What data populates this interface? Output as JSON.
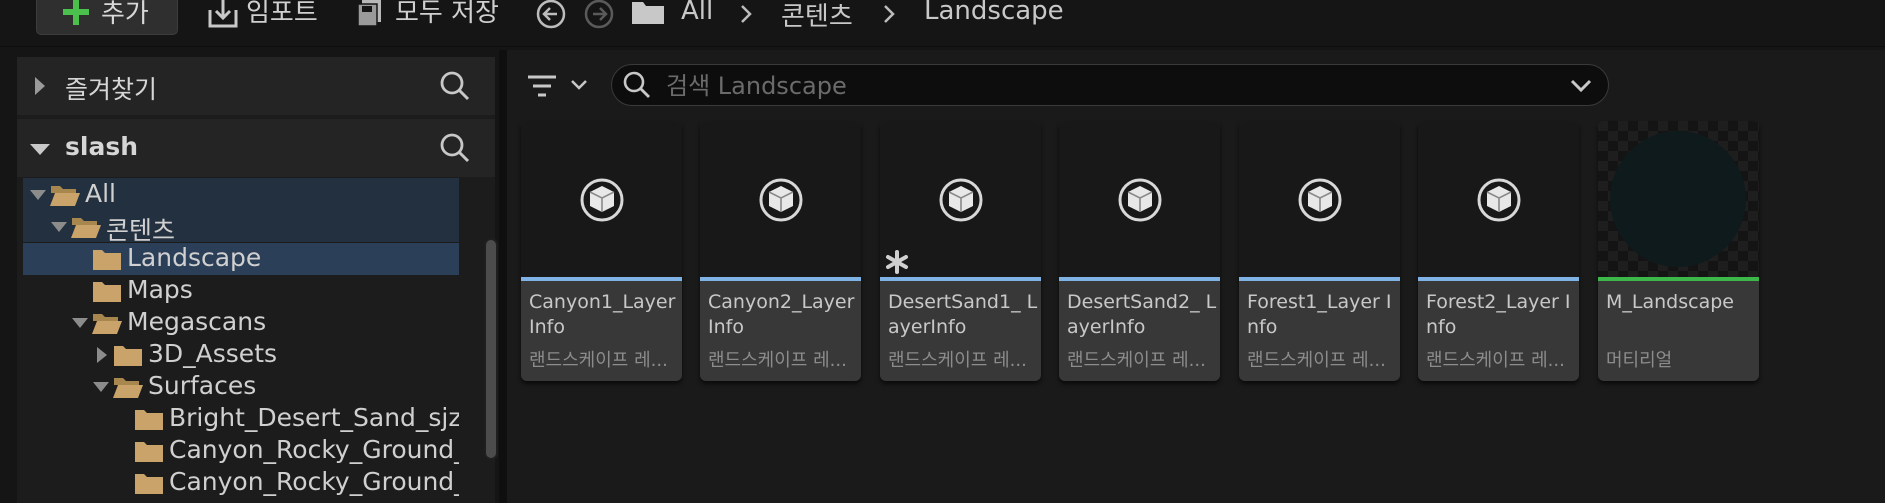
{
  "toolbar": {
    "add_label": "추가",
    "import_label": "임포트",
    "save_all_label": "모두 저장"
  },
  "breadcrumb": [
    "All",
    "콘텐츠",
    "Landscape"
  ],
  "favorites": {
    "title": "즐겨찾기"
  },
  "project": {
    "title": "slash"
  },
  "tree": {
    "items": [
      {
        "label": "All",
        "depth": 0,
        "expanded": true,
        "selected": false,
        "highlight": true
      },
      {
        "label": "콘텐츠",
        "depth": 1,
        "expanded": true,
        "selected": false,
        "highlight": true
      },
      {
        "label": "Landscape",
        "depth": 2,
        "expanded": null,
        "selected": true
      },
      {
        "label": "Maps",
        "depth": 2,
        "expanded": null,
        "selected": false
      },
      {
        "label": "Megascans",
        "depth": 2,
        "expanded": true,
        "selected": false
      },
      {
        "label": "3D_Assets",
        "depth": 3,
        "expanded": false,
        "selected": false
      },
      {
        "label": "Surfaces",
        "depth": 3,
        "expanded": true,
        "selected": false
      },
      {
        "label": "Bright_Desert_Sand_sjzl",
        "depth": 4,
        "expanded": null,
        "selected": false
      },
      {
        "label": "Canyon_Rocky_Ground_",
        "depth": 4,
        "expanded": null,
        "selected": false
      },
      {
        "label": "Canyon_Rocky_Ground_",
        "depth": 4,
        "expanded": null,
        "selected": false
      }
    ]
  },
  "search": {
    "placeholder": "검색 Landscape",
    "value": ""
  },
  "colors": {
    "layerinfo_strip": "#7fb3e6",
    "material_strip": "#3cb84a",
    "folder": "#c9a36a",
    "selection": "#2b3f58"
  },
  "assets": [
    {
      "name": "Canyon1_Layer Info",
      "type": "랜드스케이프 레...",
      "kind": "layerinfo",
      "icon": "cube-icon",
      "modified": false
    },
    {
      "name": "Canyon2_Layer Info",
      "type": "랜드스케이프 레...",
      "kind": "layerinfo",
      "icon": "cube-icon",
      "modified": false
    },
    {
      "name": "DesertSand1_ LayerInfo",
      "type": "랜드스케이프 레...",
      "kind": "layerinfo",
      "icon": "cube-icon",
      "modified": true
    },
    {
      "name": "DesertSand2_ LayerInfo",
      "type": "랜드스케이프 레...",
      "kind": "layerinfo",
      "icon": "cube-icon",
      "modified": false
    },
    {
      "name": "Forest1_Layer Info",
      "type": "랜드스케이프 레...",
      "kind": "layerinfo",
      "icon": "cube-icon",
      "modified": false
    },
    {
      "name": "Forest2_Layer Info",
      "type": "랜드스케이프 레...",
      "kind": "layerinfo",
      "icon": "cube-icon",
      "modified": false
    },
    {
      "name": "M_Landscape",
      "type": "머티리얼",
      "kind": "material",
      "icon": "material-sphere-icon",
      "modified": false
    }
  ]
}
